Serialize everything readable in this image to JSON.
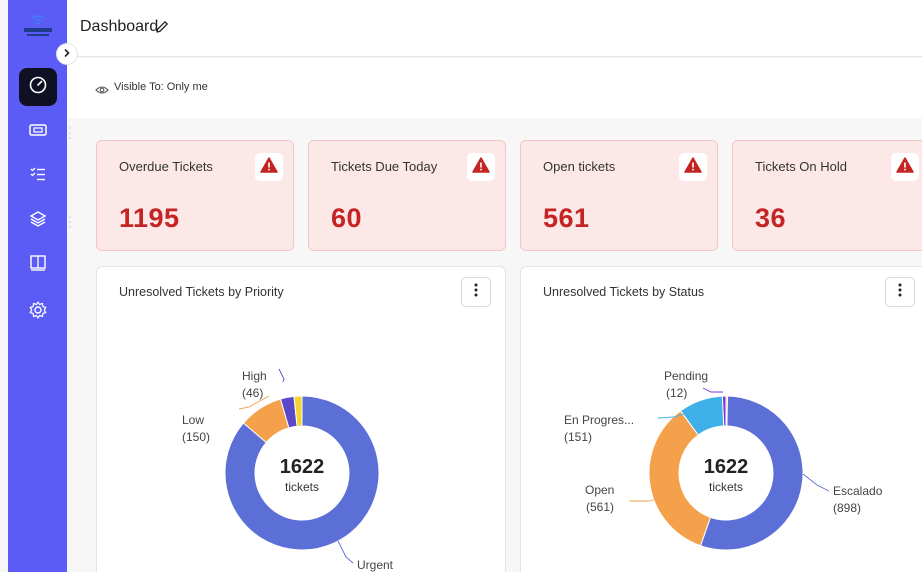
{
  "sidebar": {
    "logo_text": "INTERNET",
    "items": [
      {
        "icon": "speedometer-icon",
        "active": true
      },
      {
        "icon": "ticket-icon",
        "has_menu": true
      },
      {
        "icon": "checklist-icon"
      },
      {
        "icon": "layers-icon",
        "has_menu": true
      },
      {
        "icon": "book-icon"
      },
      {
        "icon": "gear-icon"
      }
    ],
    "accent": "#5b5bf5"
  },
  "header": {
    "title": "Dashboard"
  },
  "visibility": {
    "text": "Visible To: Only me"
  },
  "stats": [
    {
      "label": "Overdue Tickets",
      "value": "1195"
    },
    {
      "label": "Tickets Due Today",
      "value": "60"
    },
    {
      "label": "Open tickets",
      "value": "561"
    },
    {
      "label": "Tickets On Hold",
      "value": "36"
    }
  ],
  "colors": {
    "stat_bg": "#fde8e8",
    "stat_value": "#c42424",
    "warning": "#c42424"
  },
  "chart_data": [
    {
      "type": "pie",
      "title": "Unresolved Tickets by Priority",
      "center_value": "1622",
      "center_label": "tickets",
      "categories": [
        "Urgent",
        "Low",
        "High",
        ""
      ],
      "values": [
        1399,
        150,
        46,
        27
      ],
      "colors": [
        "#5b6fd6",
        "#f5a04a",
        "#5a48c9",
        "#f4d431"
      ]
    },
    {
      "type": "pie",
      "title": "Unresolved Tickets by Status",
      "center_value": "1622",
      "center_label": "tickets",
      "categories": [
        "Escalado",
        "Open",
        "En Progres...",
        "Pending",
        ""
      ],
      "values": [
        898,
        561,
        151,
        12,
        0
      ],
      "colors": [
        "#5b6fd6",
        "#f5a04a",
        "#3fb1e8",
        "#7a35e0",
        "#f4d431"
      ]
    }
  ]
}
